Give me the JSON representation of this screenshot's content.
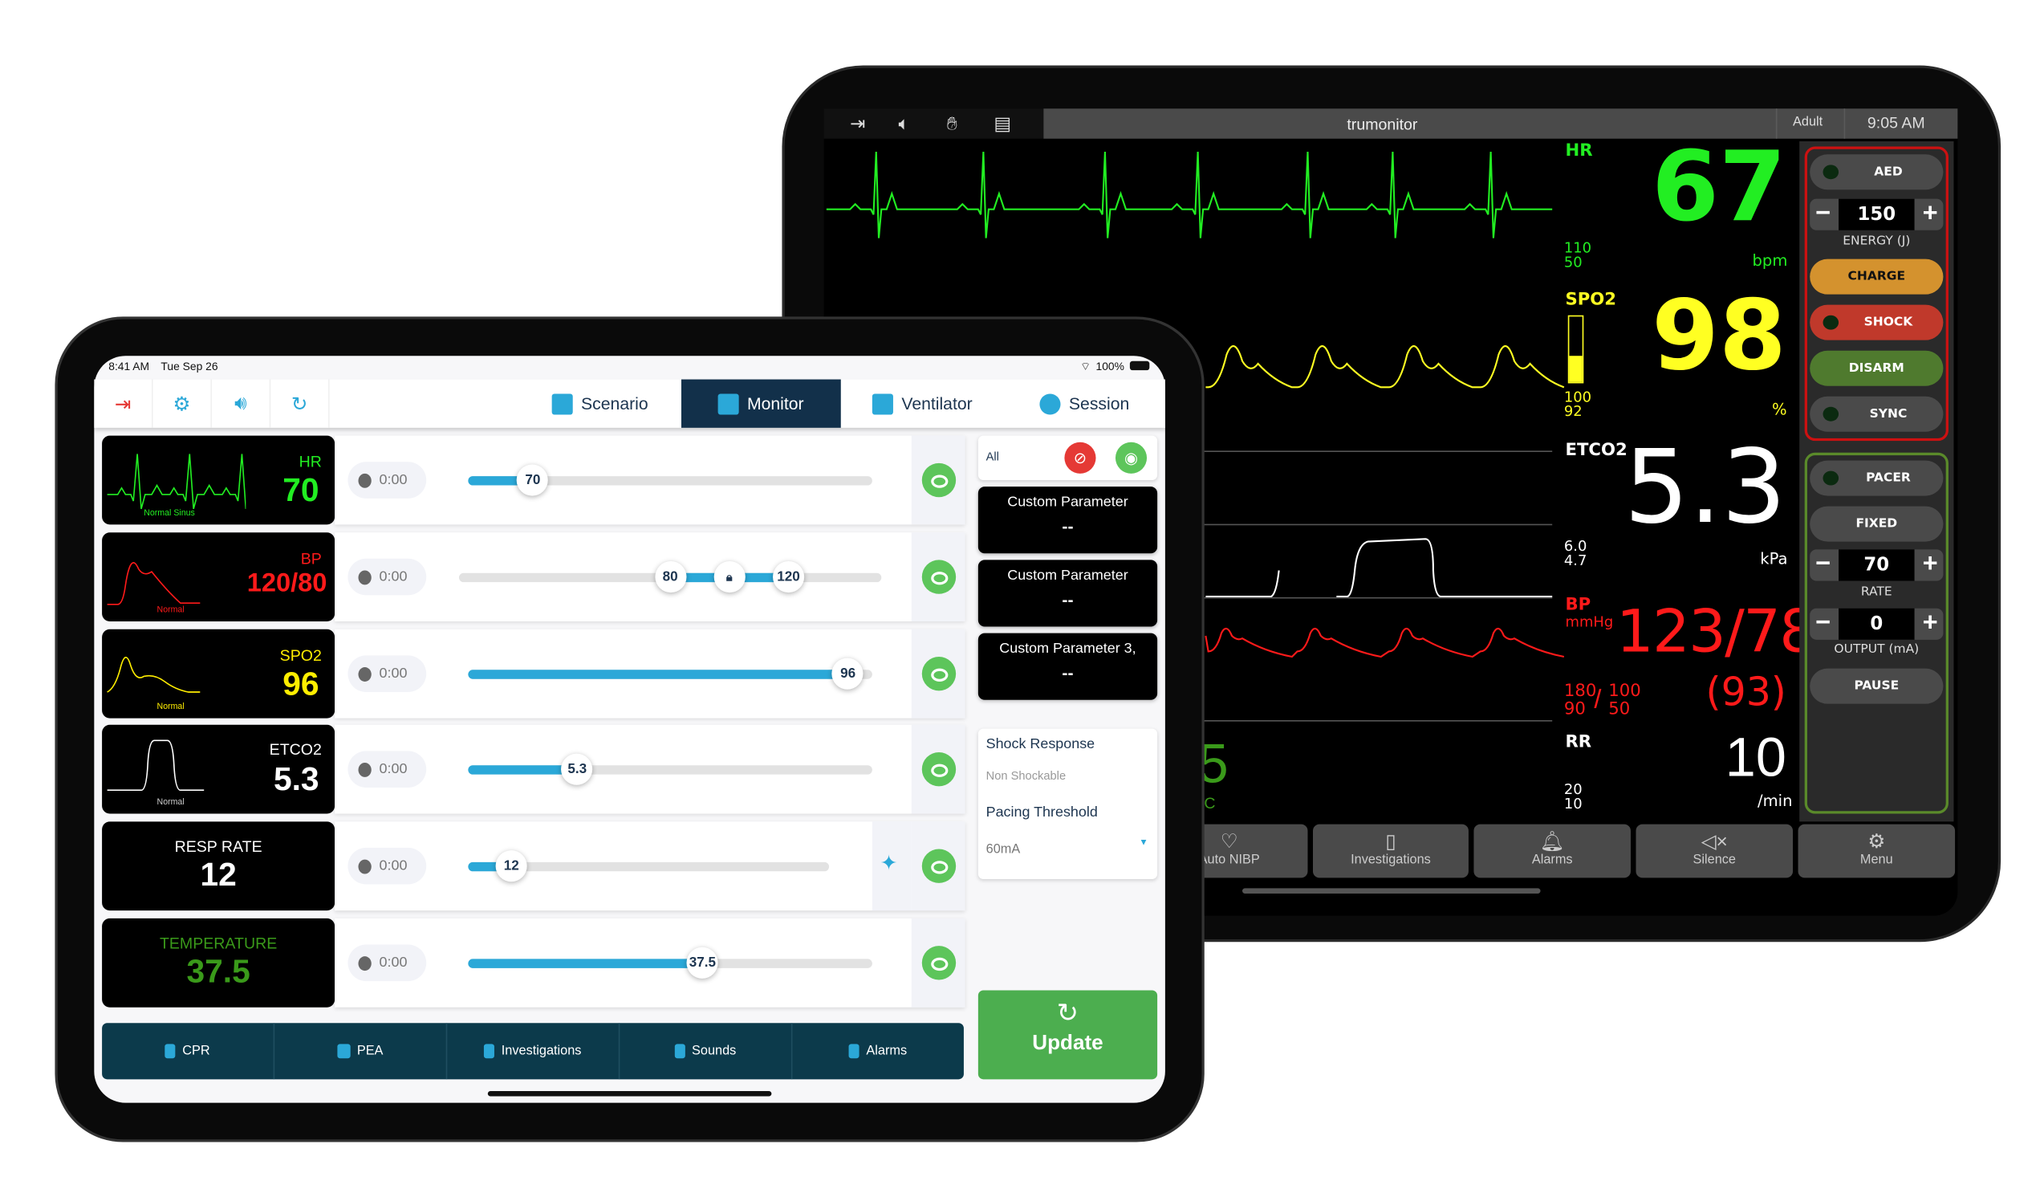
{
  "monitor_tablet": {
    "toolbar_icons": [
      "exit-icon",
      "speaker-icon",
      "cpr-hands-icon",
      "clipboard-icon"
    ],
    "brand": "trumonitor",
    "patient_type": "Adult",
    "time": "9:05 AM",
    "params": {
      "hr": {
        "label": "HR",
        "value": "67",
        "unit": "bpm",
        "high": "110",
        "low": "50",
        "color": "#22ee22"
      },
      "spo2": {
        "label": "SPO2",
        "value": "98",
        "unit": "%",
        "high": "100",
        "low": "92",
        "color": "#ffff22",
        "bar_fill_percent": 40
      },
      "etco2": {
        "label": "ETCO2",
        "value": "5.3",
        "unit": "kPa",
        "high": "6.0",
        "low": "4.7",
        "color": "#ffffff"
      },
      "bp": {
        "label": "BP",
        "unit": "mmHg",
        "value": "123/78",
        "mean": "(93)",
        "sys_high": "180",
        "sys_low": "90",
        "sep": "/",
        "dia_high": "100",
        "dia_low": "50",
        "color": "#ff1a1a"
      },
      "rr": {
        "label": "RR",
        "value": "10",
        "unit": "/min",
        "high": "20",
        "low": "10",
        "color": "#ffffff"
      },
      "temp_partial": {
        "value": "5",
        "unit": "°C",
        "color": "#3a9a1a"
      }
    },
    "defib": {
      "aed": "AED",
      "energy": "150",
      "energy_label": "ENERGY (J)",
      "charge": "CHARGE",
      "shock": "SHOCK",
      "disarm": "DISARM",
      "sync": "SYNC",
      "minus": "−",
      "plus": "+"
    },
    "pacer": {
      "pacer": "PACER",
      "mode": "FIXED",
      "rate": "70",
      "rate_label": "RATE",
      "output": "0",
      "output_label": "OUTPUT (mA)",
      "pause": "PAUSE"
    },
    "bottom_buttons": [
      {
        "label": "Auto NIBP",
        "icon": "heart-timer-icon"
      },
      {
        "label": "Investigations",
        "icon": "clipboard-icon"
      },
      {
        "label": "Alarms",
        "icon": "bell-icon"
      },
      {
        "label": "Silence",
        "icon": "speaker-mute-icon"
      },
      {
        "label": "Menu",
        "icon": "gear-icon"
      }
    ],
    "colors": {
      "defib_border": "#cc1111",
      "pacer_border": "#5a8a2a",
      "charge": "#d4922e",
      "shock": "#c0392b",
      "disarm": "#4f7a2e"
    }
  },
  "controller_tablet": {
    "status": {
      "time": "8:41 AM",
      "date": "Tue Sep 26",
      "battery": "100%"
    },
    "toolbar_icons": [
      "exit-icon",
      "gear-icon",
      "speaker-icon",
      "refresh-icon"
    ],
    "tabs": [
      {
        "label": "Scenario",
        "icon": "clipboard-icon"
      },
      {
        "label": "Monitor",
        "icon": "monitor-icon",
        "active": true
      },
      {
        "label": "Ventilator",
        "icon": "medical-kit-icon"
      },
      {
        "label": "Session",
        "icon": "people-icon"
      }
    ],
    "rows": [
      {
        "key": "hr",
        "label": "HR",
        "value": "70",
        "subtitle": "Normal Sinus",
        "color": "#22ee22",
        "timer": "0:00",
        "slider_percent": 16,
        "wave": "ecg"
      },
      {
        "key": "bp",
        "label": "BP",
        "value": "120/80",
        "subtitle": "Normal",
        "color": "#ff1a1a",
        "timer": "0:00",
        "low": "80",
        "high": "120",
        "low_percent": 50,
        "high_percent": 78,
        "wave": "art"
      },
      {
        "key": "spo2",
        "label": "SPO2",
        "value": "96",
        "subtitle": "Normal",
        "color": "#ffee00",
        "timer": "0:00",
        "slider_percent": 94,
        "wave": "pleth"
      },
      {
        "key": "etco2",
        "label": "ETCO2",
        "value": "5.3",
        "subtitle": "Normal",
        "color": "#ffffff",
        "timer": "0:00",
        "slider_percent": 27,
        "wave": "capno"
      },
      {
        "key": "rr",
        "label": "RESP RATE",
        "value": "12",
        "color": "#ffffff",
        "timer": "0:00",
        "slider_percent": 12
      },
      {
        "key": "temp",
        "label": "TEMPERATURE",
        "value": "37.5",
        "color": "#3a9a1a",
        "timer": "0:00",
        "slider_percent": 58
      }
    ],
    "filter": {
      "label": "All"
    },
    "custom_params": [
      {
        "title": "Custom Parameter",
        "value": "--"
      },
      {
        "title": "Custom Parameter",
        "value": "--"
      },
      {
        "title": "Custom Parameter 3,",
        "value": "--"
      }
    ],
    "shock_response": {
      "title": "Shock Response",
      "value": "Non Shockable"
    },
    "pacing_threshold": {
      "title": "Pacing Threshold",
      "value": "60mA"
    },
    "update_label": "Update",
    "bottom_bar": [
      {
        "label": "CPR",
        "icon": "hand-icon"
      },
      {
        "label": "PEA",
        "icon": "monitor-icon"
      },
      {
        "label": "Investigations",
        "icon": "clipboard-icon"
      },
      {
        "label": "Sounds",
        "icon": "speaker-icon"
      },
      {
        "label": "Alarms",
        "icon": "bell-icon"
      }
    ],
    "colors": {
      "accent": "#2ba8d8",
      "nav_active": "#12304a",
      "bottom_bar": "#0c3a4b",
      "update": "#4cae4f",
      "eye_on": "#5dc55b",
      "eye_off": "#e53935"
    }
  }
}
